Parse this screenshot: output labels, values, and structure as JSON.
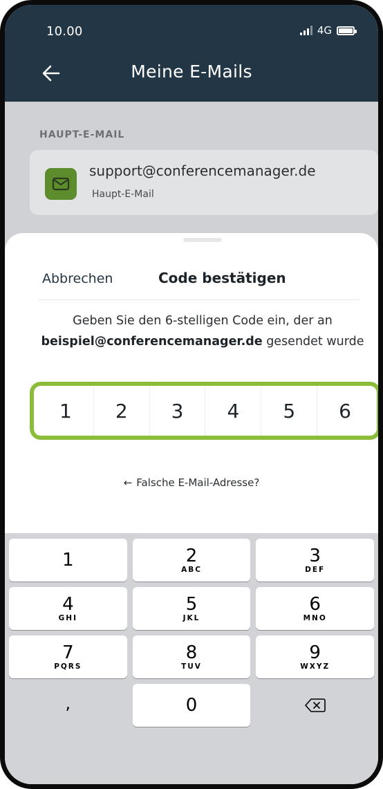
{
  "status_bar": {
    "time": "10.00",
    "network": "4G"
  },
  "header": {
    "title": "Meine E-Mails"
  },
  "main_email": {
    "section_label": "HAUPT-E-MAIL",
    "address": "support@conferencemanager.de",
    "label": "Haupt-E-Mail"
  },
  "sheet": {
    "cancel_label": "Abbrechen",
    "title": "Code bestätigen",
    "instruction_line1": "Geben Sie den 6-stelligen Code ein, der an",
    "instruction_email": "beispiel@conferencemanager.de",
    "instruction_suffix": " gesendet wurde",
    "code_digits": [
      "1",
      "2",
      "3",
      "4",
      "5",
      "6"
    ],
    "wrong_email_link": "Falsche E-Mail-Adresse?"
  },
  "keypad": {
    "keys": [
      {
        "digit": "1",
        "letters": ""
      },
      {
        "digit": "2",
        "letters": "ABC"
      },
      {
        "digit": "3",
        "letters": "DEF"
      },
      {
        "digit": "4",
        "letters": "GHI"
      },
      {
        "digit": "5",
        "letters": "JKL"
      },
      {
        "digit": "6",
        "letters": "MNO"
      },
      {
        "digit": "7",
        "letters": "PQRS"
      },
      {
        "digit": "8",
        "letters": "TUV"
      },
      {
        "digit": "9",
        "letters": "WXYZ"
      },
      {
        "digit": ",",
        "letters": ""
      },
      {
        "digit": "0",
        "letters": ""
      }
    ],
    "delete_icon": "backspace-icon"
  },
  "colors": {
    "header_bg": "#233645",
    "accent_green": "#8bbd3a",
    "mail_icon_bg": "#5c8c2c"
  }
}
